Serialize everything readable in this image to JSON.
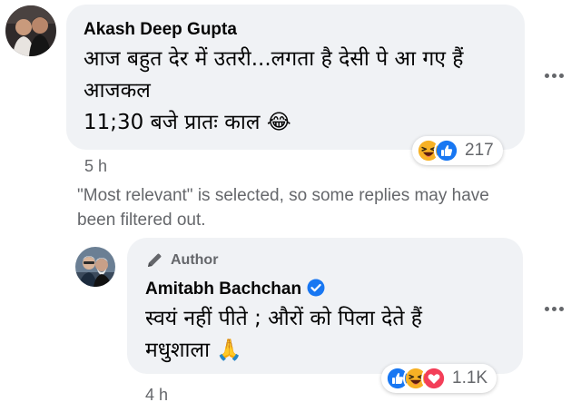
{
  "comment": {
    "author": "Akash Deep Gupta",
    "text_line1": "आज बहुत देर में उतरी...लगता है देसी पे आ गए हैं",
    "text_line2": "आजकल",
    "text_line3": "11;30 बजे प्रातः काल",
    "text_emoji": "😂",
    "time": "5 h",
    "reactions": [
      "haha",
      "like"
    ],
    "reaction_count": "217"
  },
  "filter_note": {
    "line1": "\"Most relevant\" is selected, so some replies may have",
    "line2": "been filtered out."
  },
  "reply": {
    "badge": "Author",
    "author": "Amitabh Bachchan",
    "verified": true,
    "text_line1": "स्वयं नहीं पीते ; औरों को पिला देते हैं",
    "text_line2": "मधुशाला",
    "text_emoji": "🙏",
    "time": "4 h",
    "reactions": [
      "like",
      "haha",
      "love"
    ],
    "reaction_count": "1.1K"
  },
  "colors": {
    "bubble": "#f0f2f5",
    "secondary_text": "#65676b",
    "like_blue": "#1877f2",
    "love_red": "#f33e58",
    "haha_yellow": "#f7b125"
  },
  "icons": [
    "avatar-photo",
    "pencil-icon",
    "verified-badge-icon",
    "more-options-icon",
    "like-reaction-icon",
    "haha-reaction-icon",
    "love-reaction-icon"
  ]
}
